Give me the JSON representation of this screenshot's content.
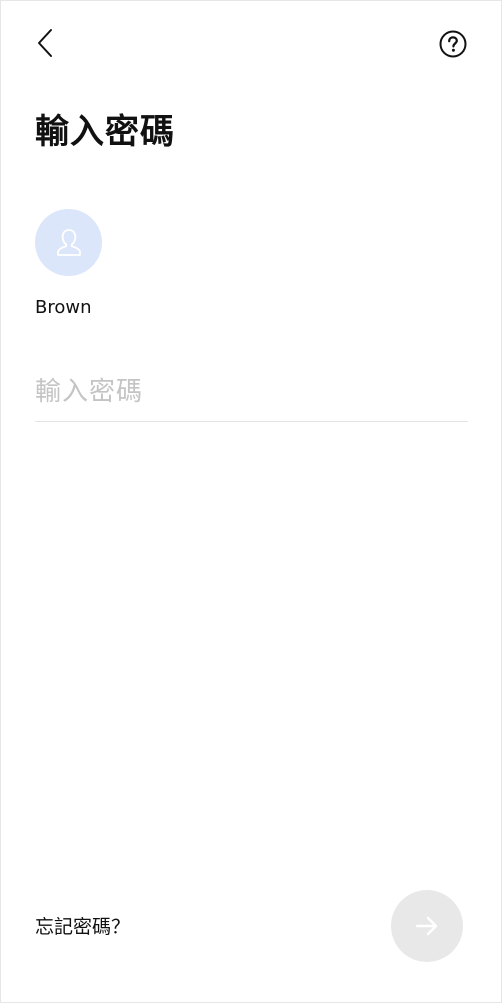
{
  "header": {
    "back_icon": "chevron-left-icon",
    "help_icon": "question-circle-icon"
  },
  "title": "輸入密碼",
  "account": {
    "avatar_icon": "user-silhouette-icon",
    "avatar_color": "#dbe6fb",
    "name": "Brown"
  },
  "password_field": {
    "placeholder": "輸入密碼",
    "value": ""
  },
  "footer": {
    "forgot_password_label": "忘記密碼？",
    "next_icon": "arrow-right-icon",
    "next_button_color": "#e8e8e8",
    "next_enabled": false
  }
}
